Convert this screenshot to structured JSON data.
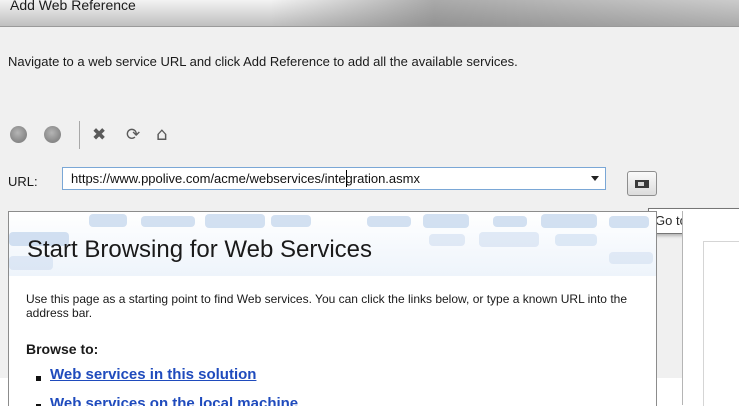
{
  "window": {
    "title": "Add Web Reference"
  },
  "instruction": "Navigate to a web service URL and click Add Reference to add all the available services.",
  "toolbar": {
    "back_icon": "circle-icon",
    "forward_icon": "circle-icon",
    "stop_icon": "x-icon",
    "refresh_icon": "refresh-icon",
    "home_icon": "home-icon"
  },
  "url_row": {
    "label": "URL:",
    "value": "https://www.ppolive.com/acme/webservices/integration.asmx"
  },
  "go_button": {
    "tooltip": "Go to https"
  },
  "browser": {
    "heading": "Start Browsing for Web Services",
    "description": "Use this page as a starting point to find Web services. You can click the links below, or type a known URL into the address bar.",
    "browse_to": "Browse to:",
    "links": [
      "Web services in this solution",
      "Web services on the local machine"
    ]
  },
  "colors": {
    "link": "#1f4bbd",
    "url_border": "#7aa7d6",
    "banner_tile": "#c7d8ee"
  }
}
